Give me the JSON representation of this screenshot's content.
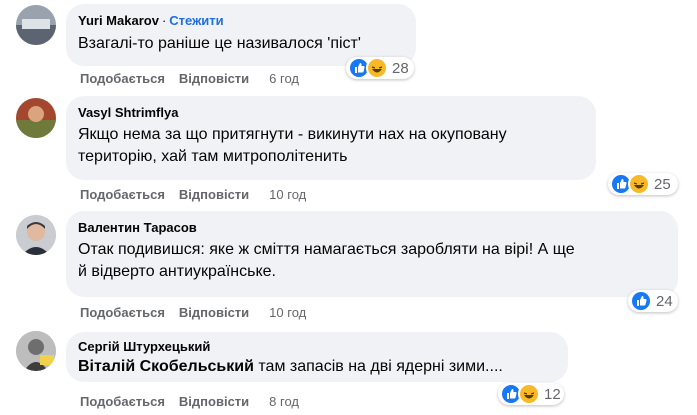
{
  "comments": [
    {
      "author": "Yuri Makarov",
      "follow": "Стежити",
      "text": "Взагалі-то раніше це називалося 'піст'",
      "like": "Подобається",
      "reply": "Відповісти",
      "time": "6 год",
      "reaction_count": "28",
      "reactions": [
        "like-icon",
        "haha-icon"
      ]
    },
    {
      "author": "Vasyl Shtrimflya",
      "text_line1": "Якщо нема за що притягнути - викинути нах на окуповану",
      "text_line2": "територію, хай там митрополітенить",
      "like": "Подобається",
      "reply": "Відповісти",
      "time": "10 год",
      "reaction_count": "25",
      "reactions": [
        "like-icon",
        "haha-icon"
      ]
    },
    {
      "author": "Валентин Тарасов",
      "text_line1": "Отак подивишся: яке ж сміття намагається заробляти на вірі! А ще",
      "text_line2": "й відверто антиукраїнське.",
      "like": "Подобається",
      "reply": "Відповісти",
      "time": "10 год",
      "reaction_count": "24",
      "reactions": [
        "like-icon"
      ]
    },
    {
      "author": "Сергій Штурхецький",
      "mention": "Віталій Скобельський",
      "text": " там запасів на дві ядерні зими....",
      "like": "Подобається",
      "reply": "Відповісти",
      "time": "8 год",
      "reaction_count": "12",
      "reactions": [
        "like-icon",
        "haha-icon"
      ]
    }
  ],
  "colors": {
    "bubble": "#f0f2f5",
    "follow": "#216fdb",
    "like": "#1877f2",
    "haha": "#f7b928",
    "meta": "#65676b"
  }
}
